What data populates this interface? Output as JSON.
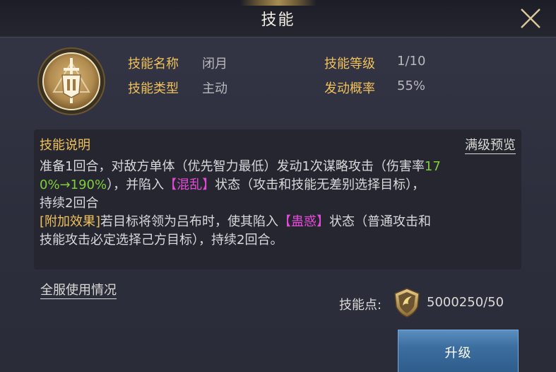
{
  "header": {
    "title": "技能"
  },
  "skill": {
    "name_label": "技能名称",
    "name_value": "闭月",
    "type_label": "技能类型",
    "type_value": "主动",
    "level_label": "技能等级",
    "level_value": "1/10",
    "rate_label": "发动概率",
    "rate_value": "55%"
  },
  "description": {
    "title": "技能说明",
    "max_preview": "满级预览",
    "line1a": "准备1回合，对敌方单体（优先智力最低）发动1次谋略攻击（伤害率",
    "line1b": "17",
    "line2a": "0%→190%",
    "line2b": "），并陷入",
    "line2c": "【混乱】",
    "line2d": "状态（攻击和技能无差别选择目标），",
    "line3": "持续2回合",
    "line4a": "[附加效果]",
    "line4b": "若目标将领为吕布时，使其陷入",
    "line4c": "【蛊惑】",
    "line4d": "状态（普通攻击和",
    "line5": "技能攻击必定选择己方目标），持续2回合。"
  },
  "footer": {
    "server_usage": "全服使用情况",
    "points_label": "技能点:",
    "points_value": "5000250/50",
    "points_icon": "skill-point-shield-icon",
    "upgrade_label": "升级"
  },
  "colors": {
    "label_gold": "#f0c15b",
    "highlight_green": "#7fcf3a",
    "highlight_pink": "#e44ad7",
    "button_blue": "#3c6e9f"
  }
}
